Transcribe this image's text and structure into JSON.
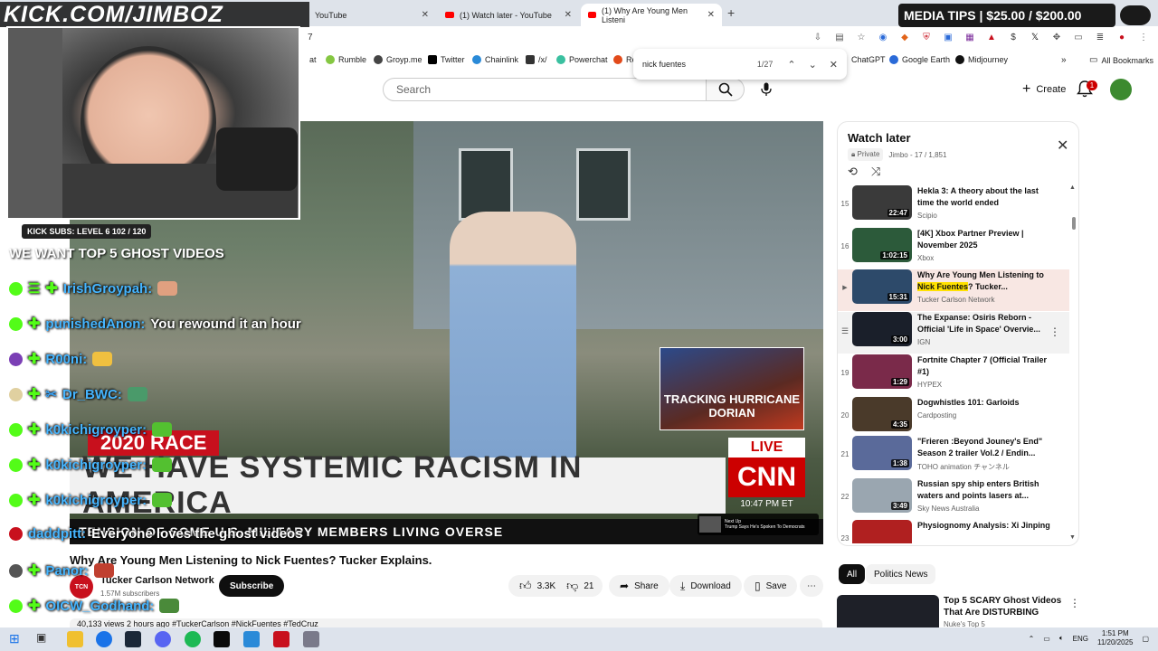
{
  "overlay": {
    "stream_title": "KICK.COM/JIMBOZ",
    "media_tips": "MEDIA TIPS | $25.00 / $200.00",
    "kick_subs": "KICK SUBS: LEVEL 6 102 / 120",
    "chat_header": "WE WANT TOP 5 GHOST VIDEOS"
  },
  "chat": [
    {
      "name": "IrishGroypah:",
      "msg": "",
      "badge_color": "#53fc18"
    },
    {
      "name": "punishedAnon:",
      "msg": "You rewound it an hour",
      "badge_color": "#53fc18"
    },
    {
      "name": "R00ni:",
      "msg": "",
      "badge_color": "#7b3fb5"
    },
    {
      "name": "Dr_BWC:",
      "msg": "",
      "badge_color": "#e0d0a0"
    },
    {
      "name": "k0kichigroyper:",
      "msg": "",
      "badge_color": "#53fc18"
    },
    {
      "name": "k0kichigroyper:",
      "msg": "",
      "badge_color": "#53fc18"
    },
    {
      "name": "k0kichigroyper:",
      "msg": "",
      "badge_color": "#53fc18"
    },
    {
      "name": "daddpitt:",
      "msg": "Everyone loves the ghost videos",
      "badge_color": "#c8101d"
    },
    {
      "name": "Panor:",
      "msg": "",
      "badge_color": "#555555"
    },
    {
      "name": "OICW_Godhand:",
      "msg": "",
      "badge_color": "#53fc18"
    }
  ],
  "browser": {
    "tabs": [
      {
        "label": "YouTube"
      },
      {
        "label": "(1) Watch later - YouTube"
      },
      {
        "label": "(1) Why Are Young Men Listeni"
      }
    ],
    "bookmarks": [
      "at",
      "Rumble",
      "Groyp.me",
      "Twitter",
      "Chainlink",
      "/x/",
      "Powerchat",
      "Re",
      "ChatGPT",
      "Google Earth",
      "Midjourney",
      "All Bookmarks"
    ],
    "find": {
      "query": "nick fuentes",
      "count": "1/27"
    },
    "address_partial": "7"
  },
  "youtube": {
    "search_placeholder": "Search",
    "create_label": "Create",
    "notif_count": "1"
  },
  "video": {
    "race_label": "2020 RACE",
    "banner": "WE HAVE SYSTEMIC RACISM IN AMERICA",
    "live": "LIVE",
    "cnn": "CNN",
    "cnn_time": "10:47 PM ET",
    "hurricane": "TRACKING HURRICANE DORIAN",
    "ticker": "TENSION OF SOME U.S. MILITARY MEMBERS LIVING OVERSE",
    "next_up": "Next Up",
    "next_up_title": "Trump Says He's Spoken To Democrats",
    "title": "Why Are Young Men Listening to Nick Fuentes? Tucker Explains.",
    "channel": "Tucker Carlson Network",
    "channel_logo": "TCN",
    "subscribers": "1.57M subscribers",
    "subscribe": "Subscribe",
    "likes": "3.3K",
    "dislikes": "21",
    "share": "Share",
    "download": "Download",
    "save": "Save",
    "views_line": "40,133 views  2 hours ago  #TuckerCarlson #NickFuentes #TedCruz"
  },
  "playlist": {
    "title": "Watch later",
    "privacy": "Private",
    "meta": "Jimbo - 17 / 1,851",
    "items": [
      {
        "idx": "15",
        "title": "Hekla 3: A theory about the last time the world ended",
        "channel": "Scipio",
        "duration": "22:47",
        "color": "#3a3a3a"
      },
      {
        "idx": "16",
        "title": "[4K] Xbox Partner Preview | November 2025",
        "channel": "Xbox",
        "duration": "1:02:15",
        "color": "#2c5a3a"
      },
      {
        "idx": "",
        "title_pre": "Why Are Young Men Listening to ",
        "title_hl": "Nick Fuentes",
        "title_post": "? Tucker...",
        "channel": "Tucker Carlson Network",
        "duration": "15:31",
        "color": "#2d4a6a"
      },
      {
        "idx": "",
        "title": "The Expanse: Osiris Reborn - Official 'Life in Space' Overvie...",
        "channel": "IGN",
        "duration": "3:00",
        "color": "#1a1f2a"
      },
      {
        "idx": "19",
        "title": "Fortnite Chapter 7 (Official Trailer #1)",
        "channel": "HYPEX",
        "duration": "1:29",
        "color": "#7a2a4a"
      },
      {
        "idx": "20",
        "title": "Dogwhistles 101: Garloids",
        "channel": "Cardposting",
        "duration": "4:35",
        "color": "#4a3a2a"
      },
      {
        "idx": "21",
        "title": "\"Frieren :Beyond Jouney's End\" Season 2 trailer Vol.2 / Endin...",
        "channel": "TOHO animation チャンネル",
        "duration": "1:38",
        "color": "#5a6a9a"
      },
      {
        "idx": "22",
        "title": "Russian spy ship enters British waters and points lasers at...",
        "channel": "Sky News Australia",
        "duration": "3:49",
        "color": "#9aa6b0"
      },
      {
        "idx": "23",
        "title": "Physiognomy Analysis: Xi Jinping",
        "channel": "",
        "duration": "",
        "color": "#b02020"
      }
    ]
  },
  "chips": [
    "All",
    "Politics News"
  ],
  "recommendation": {
    "title": "Top 5 SCARY Ghost Videos That Are DISTURBING",
    "channel": "Nuke's Top 5"
  },
  "taskbar": {
    "lang": "ENG",
    "time": "1:51 PM",
    "date": "11/20/2025"
  }
}
